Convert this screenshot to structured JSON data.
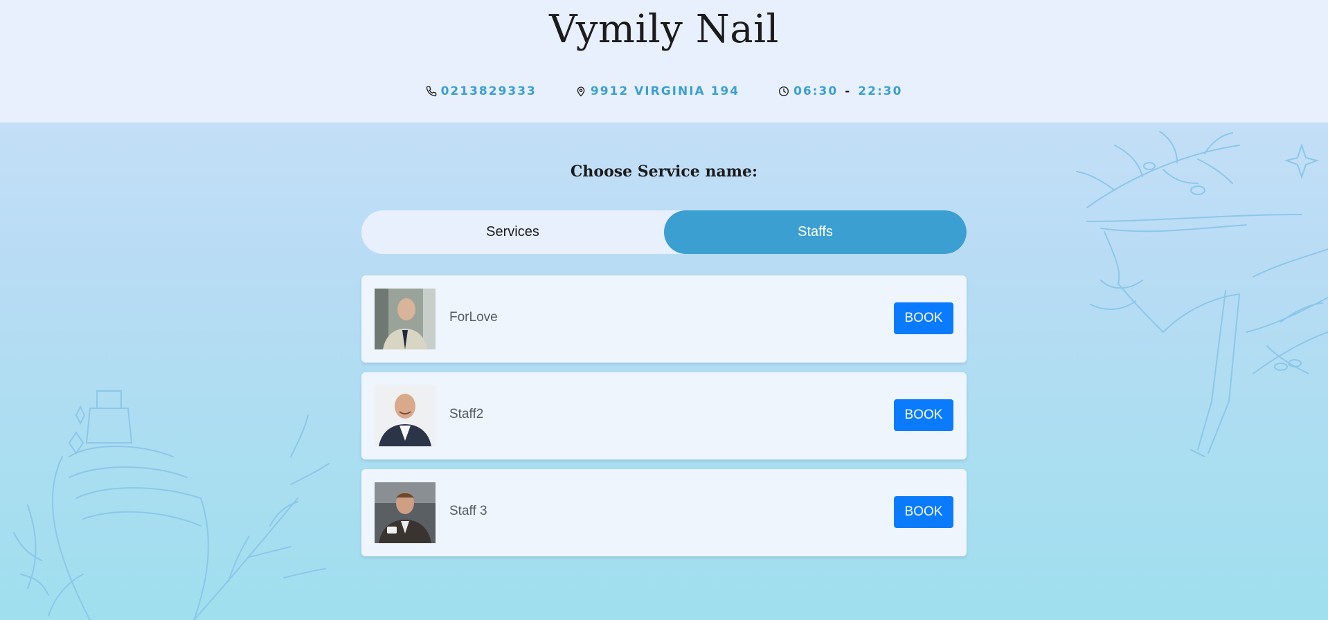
{
  "header": {
    "title": "Vymily Nail",
    "phone": "0213829333",
    "address": "9912 VIRGINIA 194",
    "hours_open": "06:30",
    "hours_sep": "-",
    "hours_close": "22:30"
  },
  "main": {
    "choose_title": "Choose Service name:",
    "tabs": [
      {
        "label": "Services",
        "active": false
      },
      {
        "label": "Staffs",
        "active": true
      }
    ],
    "staff": [
      {
        "name": "ForLove",
        "book_label": "BOOK"
      },
      {
        "name": "Staff2",
        "book_label": "BOOK"
      },
      {
        "name": "Staff 3",
        "book_label": "BOOK"
      }
    ]
  },
  "icons": {
    "phone": "phone-icon",
    "location": "location-pin-icon",
    "clock": "clock-icon"
  },
  "colors": {
    "accent": "#3c9fd1",
    "info_text": "#3aa0d1",
    "book_button": "#0a7bff",
    "header_bg": "#e8effd"
  }
}
